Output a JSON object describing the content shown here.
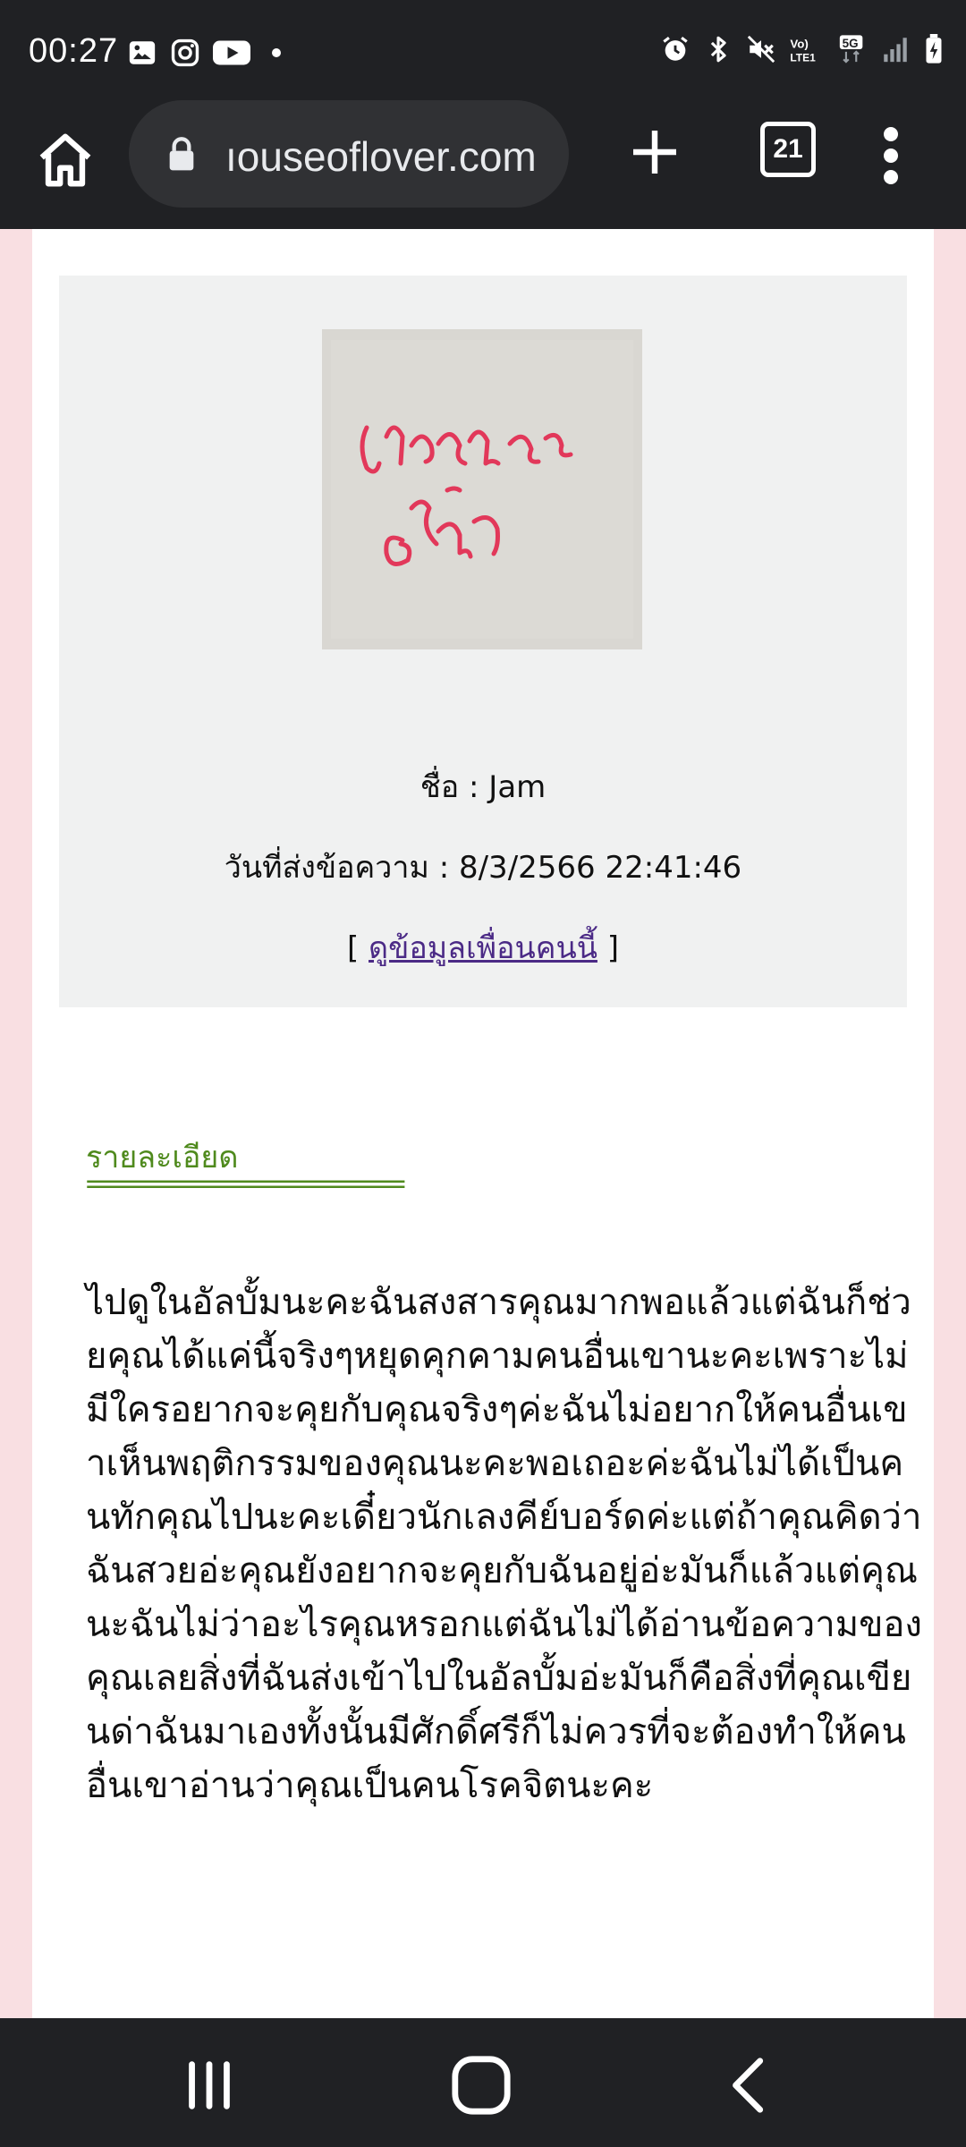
{
  "status_bar": {
    "time": "00:27",
    "icons_left": [
      "gallery-icon",
      "instagram-icon",
      "youtube-icon",
      "dot-icon"
    ],
    "icons_right": [
      "alarm-icon",
      "bluetooth-icon",
      "mute-icon",
      "volte-icon",
      "5g-icon",
      "signal-icon",
      "battery-icon"
    ]
  },
  "toolbar": {
    "url": "ıouseoflover.com",
    "tab_count": "21"
  },
  "card": {
    "name_line": "ชื่อ : Jam",
    "date_line": "วันที่ส่งข้อความ : 8/3/2566 22:41:46",
    "link_open": "[ ",
    "link_text": "ดูข้อมูลเพื่อนคนนี้",
    "link_close": " ]"
  },
  "details": {
    "title": "รายละเอียด",
    "rule": "===========================",
    "message": "ไปดูในอัลบั้มนะคะฉันสงสารคุณมากพอแล้วแต่ฉันก็ช่วยคุณได้แค่นี้จริงๆหยุดคุกคามคนอื่นเขานะคะเพราะไม่มีใครอยากจะคุยกับคุณจริงๆค่ะฉันไม่อยากให้คนอื่นเขาเห็นพฤติกรรมของคุณนะคะพอเถอะค่ะฉันไม่ได้เป็นคนทักคุณไปนะคะเดี๋ยวนักเลงคีย์บอร์ดค่ะแต่ถ้าคุณคิดว่าฉันสวยอ่ะคุณยังอยากจะคุยกับฉันอยู่อ่ะมันก็แล้วแต่คุณนะฉันไม่ว่าอะไรคุณหรอกแต่ฉันไม่ได้อ่านข้อความของคุณเลยสิ่งที่ฉันส่งเข้าไปในอัลบั้มอ่ะมันก็คือสิ่งที่คุณเขียนด่าฉันมาเองทั้งนั้นมีศักดิ์ศรีก็ไม่ควรที่จะต้องทำให้คนอื่นเขาอ่านว่าคุณเป็นคนโรคจิตนะคะ"
  },
  "photo": {
    "handwriting": "ไปตายซะ อีสุด"
  },
  "colors": {
    "browser_chrome": "#202124",
    "url_bar": "#303134",
    "page_side": "#f9dfe2",
    "card_bg": "#f0f1f1",
    "details_green": "#4f8a1d",
    "link_purple": "#4b2a86",
    "handwriting_red": "#e2385a"
  }
}
